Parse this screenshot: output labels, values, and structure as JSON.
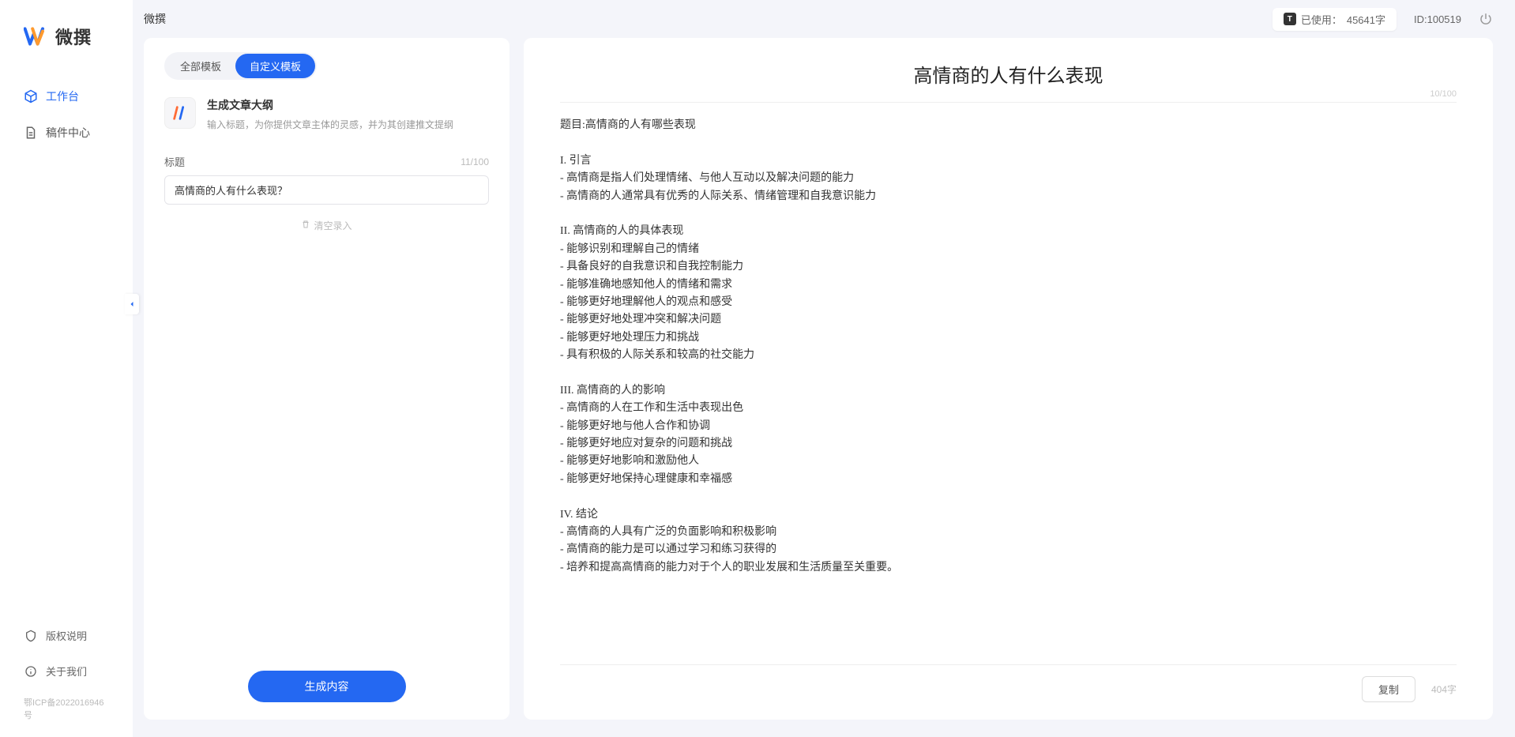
{
  "app": {
    "name": "微撰"
  },
  "sidebar": {
    "nav": [
      {
        "label": "工作台",
        "active": true
      },
      {
        "label": "稿件中心",
        "active": false
      }
    ],
    "bottom": [
      {
        "label": "版权说明"
      },
      {
        "label": "关于我们"
      }
    ],
    "icp": "鄂ICP备2022016946号"
  },
  "topbar": {
    "title": "微撰",
    "usage_prefix": "已使用：",
    "usage_value": "45641字",
    "id_label": "ID:100519"
  },
  "left": {
    "tabs": [
      {
        "label": "全部模板",
        "active": false
      },
      {
        "label": "自定义模板",
        "active": true
      }
    ],
    "template": {
      "title": "生成文章大纲",
      "desc": "输入标题，为你提供文章主体的灵感，并为其创建推文提纲"
    },
    "field_label": "标题",
    "char_counter": "11/100",
    "input_value": "高情商的人有什么表现？",
    "clear_label": "清空录入",
    "generate_label": "生成内容"
  },
  "right": {
    "title": "高情商的人有什么表现",
    "title_counter": "10/100",
    "body": "题目:高情商的人有哪些表现\n\nI. 引言\n- 高情商是指人们处理情绪、与他人互动以及解决问题的能力\n- 高情商的人通常具有优秀的人际关系、情绪管理和自我意识能力\n\nII. 高情商的人的具体表现\n- 能够识别和理解自己的情绪\n- 具备良好的自我意识和自我控制能力\n- 能够准确地感知他人的情绪和需求\n- 能够更好地理解他人的观点和感受\n- 能够更好地处理冲突和解决问题\n- 能够更好地处理压力和挑战\n- 具有积极的人际关系和较高的社交能力\n\nIII. 高情商的人的影响\n- 高情商的人在工作和生活中表现出色\n- 能够更好地与他人合作和协调\n- 能够更好地应对复杂的问题和挑战\n- 能够更好地影响和激励他人\n- 能够更好地保持心理健康和幸福感\n\nIV. 结论\n- 高情商的人具有广泛的负面影响和积极影响\n- 高情商的能力是可以通过学习和练习获得的\n- 培养和提高高情商的能力对于个人的职业发展和生活质量至关重要。",
    "copy_label": "复制",
    "word_count": "404字"
  }
}
